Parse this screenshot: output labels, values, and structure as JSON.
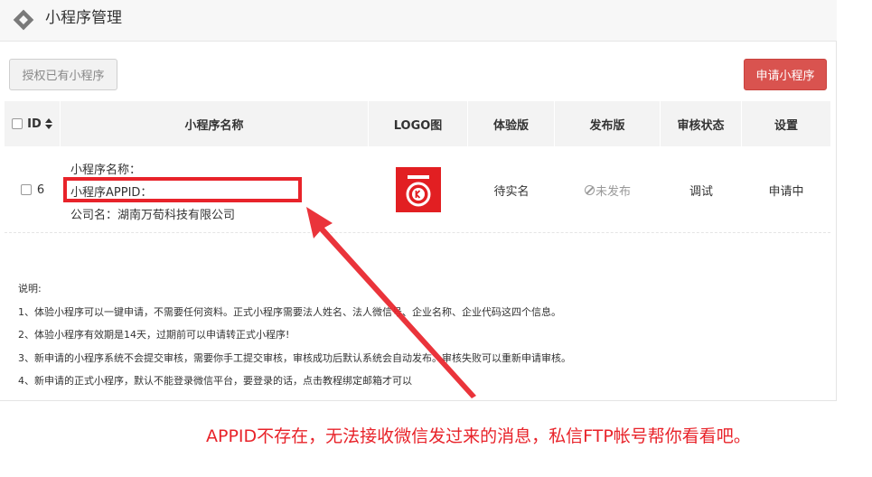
{
  "header": {
    "title": "小程序管理"
  },
  "toolbar": {
    "auth_label": "授权已有小程序",
    "apply_label": "申请小程序"
  },
  "table": {
    "columns": [
      "ID",
      "小程序名称",
      "LOGO图",
      "体验版",
      "发布版",
      "审核状态",
      "设置"
    ],
    "rows": [
      {
        "id": "6",
        "name_line": "小程序名称：",
        "appid_line": "小程序APPID：",
        "company_line": "公司名：湖南万荀科技有限公司",
        "trial": "待实名",
        "release": "未发布",
        "review": "调试",
        "settings": "申请中"
      }
    ]
  },
  "notes": {
    "title": "说明:",
    "items": [
      "1、体验小程序可以一键申请，不需要任何资料。正式小程序需要法人姓名、法人微信号、企业名称、企业代码这四个信息。",
      "2、体验小程序有效期是14天，过期前可以申请转正式小程序!",
      "3、新申请的小程序系统不会提交审核，需要你手工提交审核，审核成功后默认系统会自动发布。审核失败可以重新申请审核。",
      "4、新申请的正式小程序，默认不能登录微信平台，要登录的话，点击教程绑定邮箱才可以"
    ]
  },
  "annotation": {
    "text": "APPID不存在，无法接收微信发过来的消息，私信FTP帐号帮你看看吧。"
  },
  "colors": {
    "accent_red": "#e8232a",
    "apply_button": "#d9534f",
    "logo_red": "#e21f22"
  },
  "icons": [
    "diamond-icon",
    "sort-icon",
    "checkbox",
    "logo-icon",
    "no-publish-icon",
    "arrow"
  ]
}
